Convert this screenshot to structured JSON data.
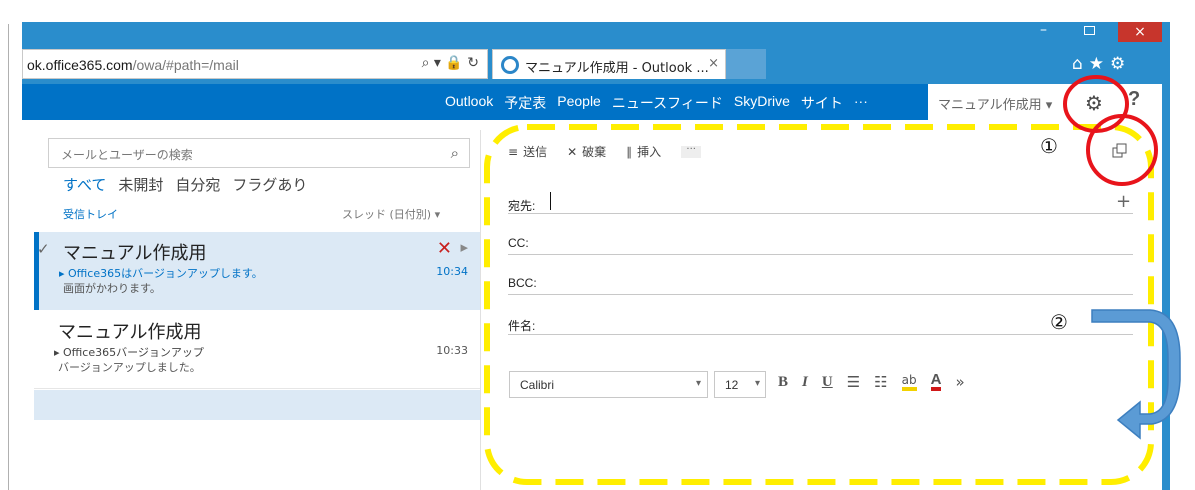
{
  "browser": {
    "address_main": "ok.office365.com",
    "address_path": "/owa/#path=/mail",
    "address_tools": "⌕ ▾ 🔒 ↻",
    "tab_title": "マニュアル作成用 - Outlook ...",
    "tab_close": "×",
    "window_min": "–",
    "window_close": "×",
    "toolbar_icons": "⌂★⚙"
  },
  "nav": {
    "items": [
      "Outlook",
      "予定表",
      "People",
      "ニュースフィード",
      "SkyDrive",
      "サイト",
      "···"
    ],
    "user": "マニュアル作成用 ▾",
    "gear": "⚙",
    "help": "?"
  },
  "mail_list": {
    "search_placeholder": "メールとユーザーの検索",
    "search_icon": "⌕",
    "filters": [
      "すべて",
      "未開封",
      "自分宛",
      "フラグあり"
    ],
    "folder": "受信トレイ",
    "sort": "スレッド (日付別) ▾",
    "messages": [
      {
        "check": "✓",
        "sender": "マニュアル作成用",
        "subject": "▸ Office365はバージョンアップします。",
        "preview": "画面がかわります。",
        "time": "10:34",
        "delete": "✕",
        "flag": "▸"
      },
      {
        "sender": "マニュアル作成用",
        "subject": "▸ Office365バージョンアップ",
        "preview": "バージョンアップしました。",
        "time": "10:33"
      }
    ]
  },
  "compose": {
    "send": "送信",
    "send_icon": "≡",
    "discard": "破棄",
    "discard_icon": "✕",
    "insert": "挿入",
    "insert_icon": "∥",
    "more": "···",
    "to_label": "宛先:",
    "to_add": "+",
    "cc_label": "CC:",
    "bcc_label": "BCC:",
    "subject_label": "件名:",
    "font": "Calibri",
    "font_caret": "▾",
    "size": "12",
    "size_caret": "▾",
    "bold": "B",
    "italic": "I",
    "underline": "U",
    "bullets": "☰",
    "numbering": "☷",
    "highlight": "ab",
    "font_color": "A",
    "more_format": "»"
  },
  "annotations": {
    "marker1": "①",
    "marker2": "②",
    "circle_color": "#e8141b",
    "dash_color": "#ffee00",
    "arrow_color": "#5b9bd5"
  },
  "colors": {
    "nav_blue": "#0072c6",
    "chrome_blue": "#2a8dcc",
    "selection": "#dce9f5"
  }
}
